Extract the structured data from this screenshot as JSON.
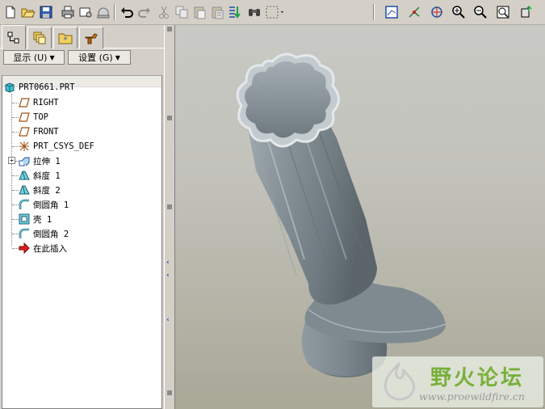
{
  "toolbar": {
    "buttons": [
      {
        "name": "new-file-icon"
      },
      {
        "name": "open-file-icon"
      },
      {
        "name": "save-icon"
      },
      {
        "name": "print-icon"
      },
      {
        "name": "send-mail-icon"
      },
      {
        "name": "mail-attach-icon"
      },
      {
        "name": "undo-icon"
      },
      {
        "name": "redo-icon"
      },
      {
        "name": "cut-icon"
      },
      {
        "name": "copy-icon"
      },
      {
        "name": "paste-icon"
      },
      {
        "name": "paste-special-icon"
      },
      {
        "name": "regenerate-icon"
      },
      {
        "name": "find-icon"
      },
      {
        "name": "select-box-icon"
      },
      {
        "name": "refit-view-icon"
      },
      {
        "name": "spin-center-icon"
      },
      {
        "name": "orient-mode-icon"
      },
      {
        "name": "zoom-in-icon"
      },
      {
        "name": "zoom-out-icon"
      },
      {
        "name": "zoom-fit-icon"
      },
      {
        "name": "reorient-icon"
      }
    ]
  },
  "panel": {
    "show_label": "显示 (U)",
    "settings_label": "设置 (G)",
    "tabs": [
      "model-tree-tab",
      "layers-tab",
      "favorites-tab",
      "tools-tab"
    ]
  },
  "tree": {
    "root": "PRT0661.PRT",
    "items": [
      {
        "label": "RIGHT",
        "icon": "datum-plane-icon"
      },
      {
        "label": "TOP",
        "icon": "datum-plane-icon"
      },
      {
        "label": "FRONT",
        "icon": "datum-plane-icon"
      },
      {
        "label": "PRT_CSYS_DEF",
        "icon": "coordinate-system-icon"
      },
      {
        "label": "拉伸 1",
        "icon": "extrude-icon"
      },
      {
        "label": "斜度 1",
        "icon": "draft-icon"
      },
      {
        "label": "斜度 2",
        "icon": "draft-icon"
      },
      {
        "label": "倒圆角 1",
        "icon": "round-icon"
      },
      {
        "label": "壳 1",
        "icon": "shell-icon"
      },
      {
        "label": "倒圆角 2",
        "icon": "round-icon"
      },
      {
        "label": "在此插入",
        "icon": "insert-here-icon"
      }
    ]
  },
  "watermark": {
    "title": "野火论坛",
    "url": "www.proewildfire.cn"
  },
  "colors": {
    "viewport_top": "#c9c9c5",
    "viewport_bottom": "#a9a897",
    "model_body": "#7e8990",
    "accent_blue": "#2050a8"
  }
}
